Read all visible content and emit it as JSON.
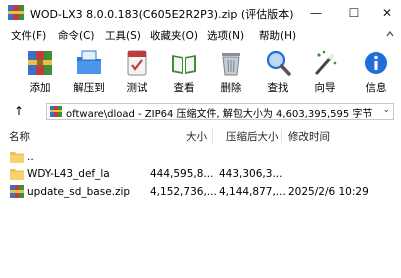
{
  "window": {
    "title": "WOD-LX3 8.0.0.183(C605E2R2P3).zip (评估版本)",
    "minimize": "—",
    "maximize": "☐",
    "close": "✕"
  },
  "menu": {
    "items": [
      "文件(F)",
      "命令(C)",
      "工具(S)",
      "收藏夹(O)",
      "选项(N)",
      "帮助(H)"
    ]
  },
  "toolbar": {
    "tools": [
      {
        "label": "添加",
        "icon": "add-archive-icon"
      },
      {
        "label": "解压到",
        "icon": "extract-to-icon"
      },
      {
        "label": "测试",
        "icon": "test-icon"
      },
      {
        "label": "查看",
        "icon": "view-book-icon"
      },
      {
        "label": "删除",
        "icon": "delete-trash-icon"
      },
      {
        "label": "查找",
        "icon": "find-magnifier-icon"
      },
      {
        "label": "向导",
        "icon": "wizard-wand-icon"
      },
      {
        "label": "信息",
        "icon": "info-icon"
      }
    ]
  },
  "address": {
    "up": "↑",
    "path": "oftware\\dload - ZIP64 压缩文件, 解包大小为 4,603,395,595 字节",
    "caret": "⌄"
  },
  "columns": {
    "name": "名称",
    "size": "大小",
    "packed": "压缩后大小",
    "modified": "修改时间"
  },
  "rows": [
    {
      "name": "..",
      "size": "",
      "packed": "",
      "modified": "",
      "icon": "folder-up-icon"
    },
    {
      "name": "WDY-L43_def_la",
      "size": "444,595,8...",
      "packed": "443,306,3...",
      "modified": "",
      "icon": "folder-icon"
    },
    {
      "name": "update_sd_base.zip",
      "size": "4,152,736,...",
      "packed": "4,144,877,...",
      "modified": "2025/2/6 10:29",
      "icon": "zip-archive-icon"
    }
  ],
  "colors": {
    "folder": "#f2c14e",
    "accent": "#1e6fd9"
  }
}
